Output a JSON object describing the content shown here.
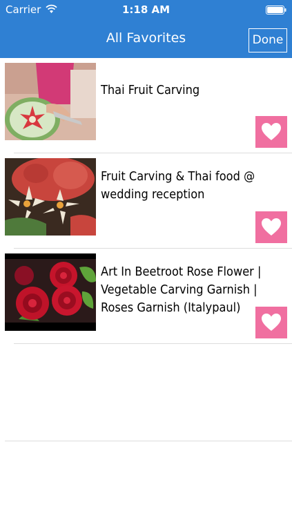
{
  "status_bar": {
    "carrier": "Carrier",
    "time": "1:18 AM"
  },
  "nav": {
    "title": "All Favorites",
    "done_label": "Done"
  },
  "favorites": [
    {
      "title": "Thai Fruit Carving",
      "thumbnail": "carved-watermelon-image",
      "favorited": true
    },
    {
      "title": "Fruit Carving  & Thai food @ wedding reception",
      "thumbnail": "carved-fruit-flowers-image",
      "favorited": true
    },
    {
      "title": "Art In Beetroot Rose Flower | Vegetable Carving Garnish | Roses Garnish (Italypaul)",
      "thumbnail": "beetroot-roses-image",
      "favorited": true
    }
  ],
  "icons": {
    "wifi": "wifi-icon",
    "battery": "battery-icon",
    "heart": "heart-icon"
  },
  "colors": {
    "nav_background": "#2f80d3",
    "heart_button": "#f06fa0",
    "divider": "#dcdcdc"
  }
}
